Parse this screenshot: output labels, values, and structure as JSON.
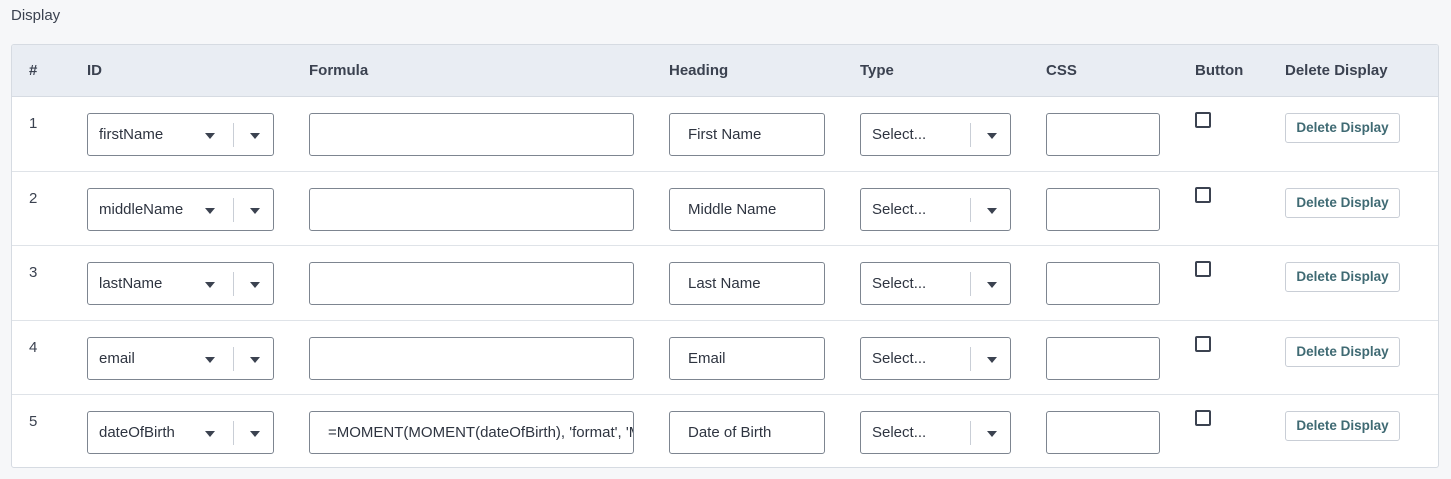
{
  "section": {
    "title": "Display"
  },
  "table": {
    "headers": {
      "num": "#",
      "id": "ID",
      "formula": "Formula",
      "heading": "Heading",
      "type": "Type",
      "css": "CSS",
      "button": "Button",
      "delete": "Delete Display"
    },
    "rows": [
      {
        "num": "1",
        "id": "firstName",
        "formula": "",
        "heading": "First Name",
        "type": "Select...",
        "css": "",
        "button_checked": false,
        "delete_label": "Delete Display"
      },
      {
        "num": "2",
        "id": "middleName",
        "formula": "",
        "heading": "Middle Name",
        "type": "Select...",
        "css": "",
        "button_checked": false,
        "delete_label": "Delete Display"
      },
      {
        "num": "3",
        "id": "lastName",
        "formula": "",
        "heading": "Last Name",
        "type": "Select...",
        "css": "",
        "button_checked": false,
        "delete_label": "Delete Display"
      },
      {
        "num": "4",
        "id": "email",
        "formula": "",
        "heading": "Email",
        "type": "Select...",
        "css": "",
        "button_checked": false,
        "delete_label": "Delete Display"
      },
      {
        "num": "5",
        "id": "dateOfBirth",
        "formula": "=MOMENT(MOMENT(dateOfBirth), 'format', 'MM/DD/YYYY')",
        "heading": "Date of Birth",
        "type": "Select...",
        "css": "",
        "button_checked": false,
        "delete_label": "Delete Display"
      }
    ]
  },
  "icons": {
    "caret": "caret-down-icon"
  }
}
